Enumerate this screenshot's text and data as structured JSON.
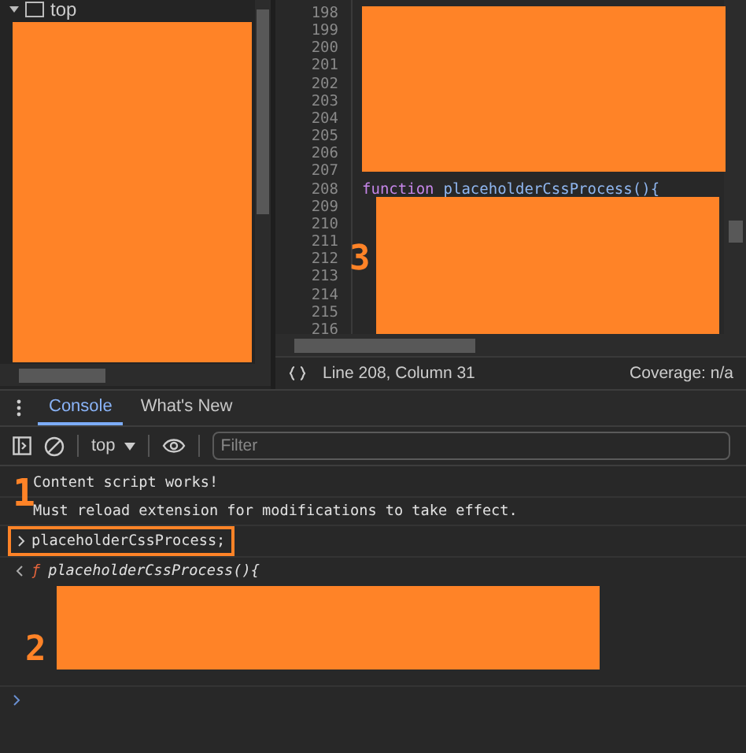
{
  "navigator": {
    "tree_items": [
      {
        "label": "top",
        "expanded": true
      }
    ]
  },
  "editor": {
    "lines": [
      {
        "number": "198"
      },
      {
        "number": "199"
      },
      {
        "number": "200"
      },
      {
        "number": "201"
      },
      {
        "number": "202"
      },
      {
        "number": "203"
      },
      {
        "number": "204"
      },
      {
        "number": "205"
      },
      {
        "number": "206"
      },
      {
        "number": "207"
      },
      {
        "number": "208",
        "tokens": [
          {
            "kind": "keyword",
            "text": "function"
          },
          {
            "kind": "name",
            "text": "placeholderCssProcess(){"
          }
        ]
      },
      {
        "number": "209"
      },
      {
        "number": "210"
      },
      {
        "number": "211"
      },
      {
        "number": "212"
      },
      {
        "number": "213"
      },
      {
        "number": "214"
      },
      {
        "number": "215"
      },
      {
        "number": "216"
      }
    ],
    "annotation": "3"
  },
  "status_bar": {
    "position": "Line 208, Column 31",
    "coverage": "Coverage: n/a"
  },
  "drawer_tabs": [
    {
      "label": "Console",
      "selected": true
    },
    {
      "label": "What's New",
      "selected": false
    }
  ],
  "toolbar": {
    "context": "top",
    "filter": {
      "placeholder": "Filter"
    }
  },
  "console": {
    "annotations": [
      "1",
      "2"
    ],
    "messages": [
      {
        "kind": "log",
        "text": "Content script works!"
      },
      {
        "kind": "log",
        "text": "Must reload extension for modifications to take effect."
      },
      {
        "kind": "input",
        "text": "placeholderCssProcess;",
        "highlighted": true
      },
      {
        "kind": "result",
        "prefix": "ƒ",
        "text": "placeholderCssProcess(){"
      },
      {
        "kind": "prompt"
      }
    ]
  }
}
